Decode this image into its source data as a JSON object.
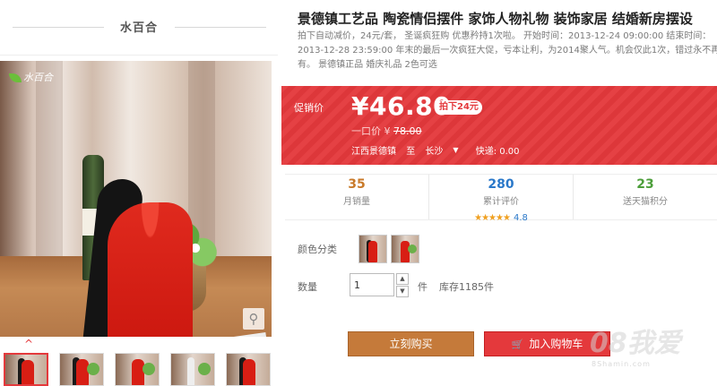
{
  "brand": {
    "name": "水百合",
    "logo_text": "水百合"
  },
  "product": {
    "title": "景德镇工艺品 陶瓷情侣摆件 家饰人物礼物 装饰家居 结婚新房摆设",
    "subtitle": "拍下自动减价，24元/套， 圣诞疯狂购 优惠矜持1次啦。 开始时间：2013-12-24 09:00:00 结束时间：2013-12-28 23:59:00 年末的最后一次疯狂大促，亏本让利，为2014聚人气。机会仅此1次，错过永不再有。 景德镇正品 婚庆礼品 2色可选"
  },
  "price": {
    "promo_label": "促销价",
    "promo_value": "¥46.80",
    "discount_badge": "拍下24元",
    "orig_label": "一口价 ¥",
    "orig_value": "78.00"
  },
  "shipping": {
    "from": "江西景德镇",
    "to_label": "至",
    "to": "长沙",
    "fee": "快递: 0.00"
  },
  "stats": [
    {
      "value": "35",
      "label": "月销量"
    },
    {
      "value": "280",
      "label": "累计评价",
      "stars": "★★★★★",
      "rating": "4.8"
    },
    {
      "value": "23",
      "label": "送天猫积分"
    }
  ],
  "options": {
    "color_label": "颜色分类",
    "qty_label": "数量",
    "qty_value": "1",
    "qty_unit": "件",
    "stock": "库存1185件"
  },
  "actions": {
    "buy_now": "立刻购买",
    "add_to_cart": "加入购物车"
  },
  "watermark": {
    "main": "08我爱",
    "sub": "8Shamin.com"
  },
  "icons": {
    "zoom": "⚲",
    "chevron_up": "^",
    "chevron_down": "▼",
    "qty_up": "▲",
    "qty_down": "▼",
    "cart": "🛒"
  },
  "colors": {
    "accent": "#e4393c",
    "buy_button": "#c57a3a"
  }
}
